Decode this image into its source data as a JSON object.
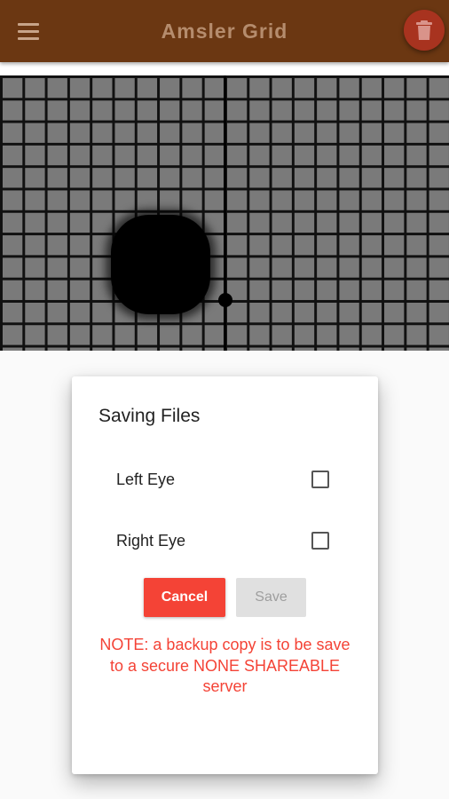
{
  "app_bar": {
    "title": "Amsler Grid",
    "menu_icon": "hamburger-menu-icon",
    "action_icon": "trash-icon",
    "background_color": "#6b3712",
    "action_color": "#a8331f"
  },
  "dialog": {
    "title": "Saving Files",
    "options": [
      {
        "label": "Left Eye",
        "checked": false
      },
      {
        "label": "Right Eye",
        "checked": false
      }
    ],
    "cancel_label": "Cancel",
    "save_label": "Save",
    "note": "NOTE: a backup copy is to be save to a secure NONE SHAREABLE server",
    "accent_color": "#f44336"
  }
}
